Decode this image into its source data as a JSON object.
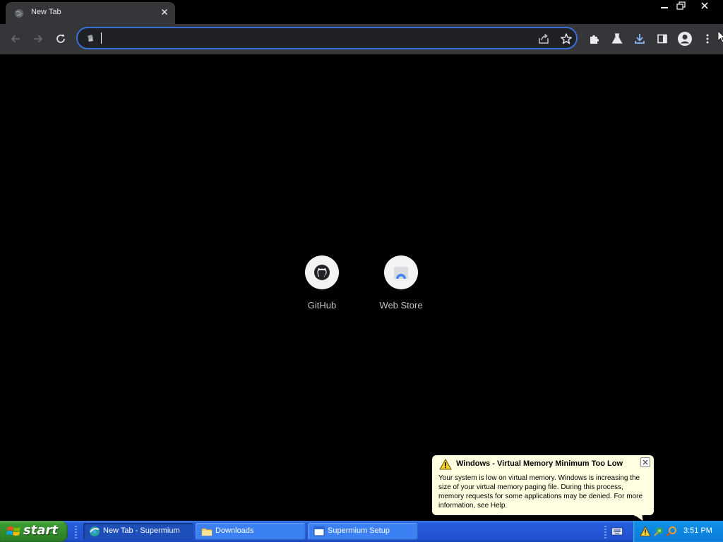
{
  "browser": {
    "tab": {
      "title": "New Tab",
      "favicon": "globe-icon"
    },
    "window_controls": [
      "minimize-icon",
      "restore-icon",
      "close-icon"
    ],
    "toolbar": {
      "nav": [
        "back-arrow-icon",
        "forward-arrow-icon",
        "reload-icon"
      ],
      "omnibox": {
        "value": "",
        "placeholder": "",
        "left_icon": "site-info-icon",
        "right_icons": [
          "share-icon",
          "star-icon"
        ]
      },
      "actions": [
        "extensions-icon",
        "labs-flask-icon",
        "download-icon",
        "side-panel-icon",
        "profile-avatar-icon",
        "menu-kebab-icon"
      ]
    }
  },
  "new_tab": {
    "shortcuts": [
      {
        "label": "GitHub",
        "icon": "github-icon"
      },
      {
        "label": "Web Store",
        "icon": "web-store-icon"
      }
    ]
  },
  "balloon": {
    "title": "Windows - Virtual Memory Minimum Too Low",
    "body": "Your system is low on virtual memory. Windows is increasing the size of your virtual memory paging file. During this process, memory requests for some applications may be denied. For more information, see Help.",
    "icon": "warning-icon"
  },
  "taskbar": {
    "start_label": "start",
    "tasks": [
      {
        "label": "New Tab - Supermium",
        "icon": "supermium-icon",
        "active": true
      },
      {
        "label": "Downloads",
        "icon": "folder-icon",
        "active": false
      },
      {
        "label": "Supermium Setup",
        "icon": "window-icon",
        "active": false
      }
    ],
    "tray_icons": [
      "warning-icon",
      "network-icon",
      "search-icon"
    ],
    "clock": "3:51 PM"
  },
  "colors": {
    "accent_focus": "#3b6fd8",
    "download_blue": "#8ab4f8",
    "taskbar_blue": "#245edb",
    "start_green": "#3c9a34",
    "balloon_bg": "#ffffe1"
  }
}
